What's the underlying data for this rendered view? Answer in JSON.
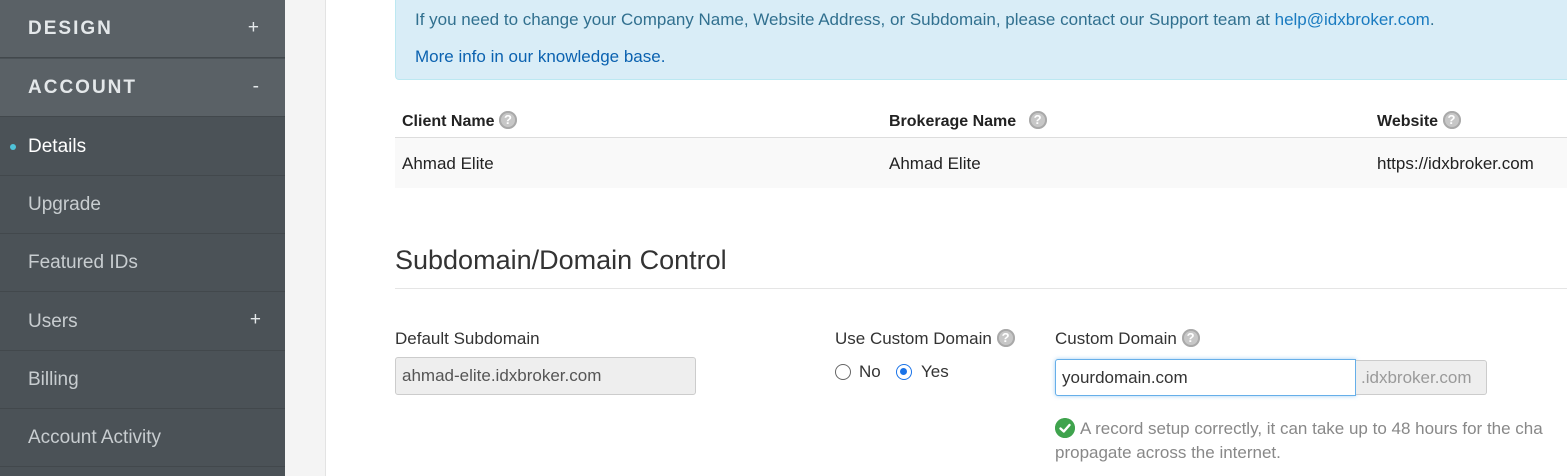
{
  "sidebar": {
    "sections": [
      {
        "label": "DESIGN",
        "toggle": "+"
      },
      {
        "label": "ACCOUNT",
        "toggle": "-"
      }
    ],
    "items": [
      {
        "label": "Details"
      },
      {
        "label": "Upgrade"
      },
      {
        "label": "Featured IDs"
      },
      {
        "label": "Users",
        "toggle": "+"
      },
      {
        "label": "Billing"
      },
      {
        "label": "Account Activity"
      }
    ]
  },
  "info": {
    "text": "If you need to change your Company Name, Website Address, or Subdomain, please contact our Support team at ",
    "email": "help@idxbroker.com",
    "period": ".",
    "kb_link": "More info in our knowledge base."
  },
  "table": {
    "headers": [
      "Client Name",
      "Brokerage Name",
      "Website"
    ],
    "help_icon": "?",
    "row": [
      "Ahmad Elite",
      "Ahmad Elite",
      "https://idxbroker.com"
    ]
  },
  "domain": {
    "title": "Subdomain/Domain Control",
    "default_subdomain_label": "Default Subdomain",
    "default_subdomain_value": "ahmad-elite.idxbroker.com",
    "use_custom_label": "Use Custom Domain",
    "option_no": "No",
    "option_yes": "Yes",
    "selected": "Yes",
    "custom_domain_label": "Custom Domain",
    "custom_domain_value": "yourdomain.com",
    "custom_domain_suffix": ".idxbroker.com",
    "status_line1": "A record setup correctly, it can take up to 48 hours for the cha",
    "status_line2": "propagate across the internet.",
    "status_color": "#3fa34d"
  },
  "colors": {
    "sidebar_bg": "#4b5257",
    "accent": "#4fc3d9",
    "info_bg": "#d9edf7",
    "link": "#1a7bc0"
  }
}
